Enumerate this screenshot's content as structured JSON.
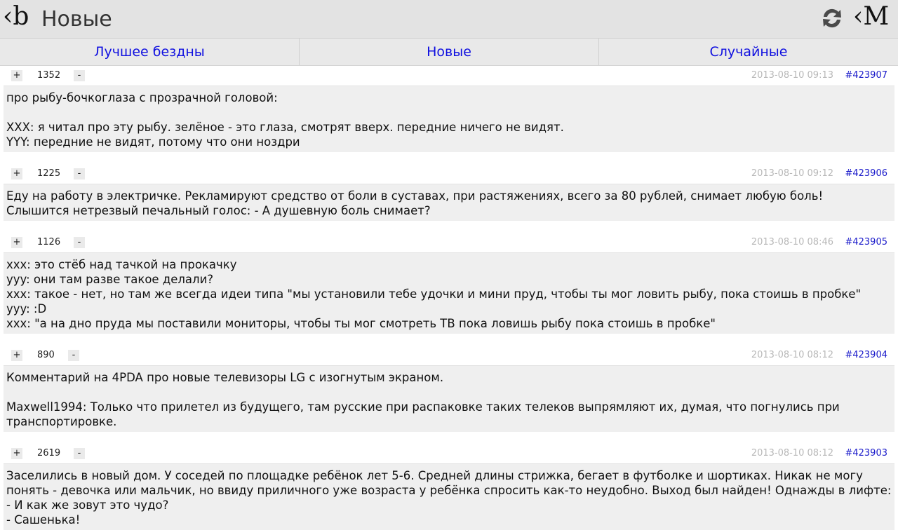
{
  "header": {
    "logo": "‹b",
    "title": "Новые",
    "refresh_icon": "refresh-icon",
    "m_logo": "‹M"
  },
  "tabs": [
    {
      "label": "Лучшее бездны"
    },
    {
      "label": "Новые"
    },
    {
      "label": "Случайные"
    }
  ],
  "quotes": [
    {
      "plus": "+",
      "minus": "-",
      "rating": "1352",
      "date": "2013-08-10 09:13",
      "id": "#423907",
      "text": "про рыбу-бочкоглаза с прозрачной головой:\n\nXXX: я читал про эту рыбу. зелёное - это глаза, смотрят вверх. передние ничего не видят.\nYYY: передние не видят, потому что они ноздри"
    },
    {
      "plus": "+",
      "minus": "-",
      "rating": "1225",
      "date": "2013-08-10 09:12",
      "id": "#423906",
      "text": "Еду на работу в электричке. Рекламируют средство от боли в суставах, при растяжениях, всего за 80 рублей, снимает любую боль!\nСлышится нетрезвый печальный голос: - А душевную боль снимает?"
    },
    {
      "plus": "+",
      "minus": "-",
      "rating": "1126",
      "date": "2013-08-10 08:46",
      "id": "#423905",
      "text": "xxx: это стёб над тачкой на прокачку\nyyy: они там разве такое делали?\nxxx: такое - нет, но там же всегда идеи типа \"мы установили тебе удочки и мини пруд, чтобы ты мог ловить рыбу, пока стоишь в пробке\"\nyyy: :D\nxxx: \"а на дно пруда мы поставили мониторы, чтобы ты мог смотреть ТВ пока ловишь рыбу пока стоишь в пробке\""
    },
    {
      "plus": "+",
      "minus": "-",
      "rating": "890",
      "date": "2013-08-10 08:12",
      "id": "#423904",
      "text": "Комментарий на 4PDA про новые телевизоры LG с изогнутым экраном.\n\nMaxwell1994: Только что прилетел из будущего, там русские при распаковке таких телеков выпрямляют их, думая, что погнулись при транспортировке."
    },
    {
      "plus": "+",
      "minus": "-",
      "rating": "2619",
      "date": "2013-08-10 08:12",
      "id": "#423903",
      "text": "Заселились в новый дом. У соседей по площадке ребёнок лет 5-6. Средней длины стрижка, бегает в футболке и шортиках. Никак не могу понять - девочка или мальчик, но ввиду приличного уже возраста у ребёнка спросить как-то неудобно. Выход был найден! Однажды в лифте:\n- И как же зовут это чудо?\n- Сашенька!"
    }
  ]
}
